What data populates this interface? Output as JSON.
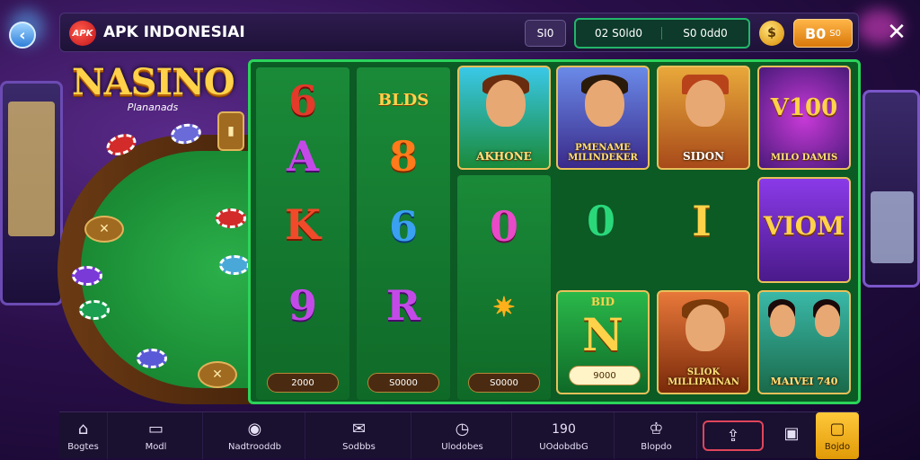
{
  "header": {
    "logo_text": "APK",
    "title": "APK INDONESIAI",
    "left_button": "SI0",
    "balance_left": "02 S0ld0",
    "balance_right": "S0 0dd0",
    "coin_icon": "coin-icon",
    "gold_button": "B0",
    "gold_button_small": "S0"
  },
  "brand": {
    "name": "NASINO",
    "subtitle": "Plananads"
  },
  "reels": [
    {
      "symbols": [
        "6",
        "A",
        "K",
        "9"
      ],
      "pill": "2000"
    },
    {
      "top_badge": "BLDS",
      "symbols": [
        "8",
        "6",
        "R"
      ],
      "pill": "S0000"
    },
    {
      "symbols": [
        "0"
      ],
      "pill": "S0000"
    }
  ],
  "middle_symbols": [
    "0",
    "I"
  ],
  "tiles": [
    {
      "label": "AKHONE"
    },
    {
      "label": "PMENAME MILINDEKER"
    },
    {
      "label": "SIDON"
    },
    {
      "label": "V100",
      "caption": "MILO DAMIS"
    },
    {
      "label": "VIOM"
    },
    {
      "label": "N",
      "badge": "BID",
      "pill": "9000"
    },
    {
      "label": "SLIOK MILLIPAINAN"
    },
    {
      "label": "MAIVEI 740"
    }
  ],
  "nav": [
    {
      "label": "Bogtes",
      "icon": "home-icon"
    },
    {
      "label": "Modl",
      "icon": "bag-icon"
    },
    {
      "label": "Nadtrooddb",
      "icon": "spin-icon"
    },
    {
      "label": "Sodbbs",
      "icon": "mail-icon"
    },
    {
      "label": "Ulodobes",
      "icon": "clock-icon"
    },
    {
      "label": "UOdobdbG",
      "value": "190",
      "icon": ""
    },
    {
      "label": "Blopdo",
      "icon": "trophy-icon"
    },
    {
      "label": "",
      "icon": "share-icon"
    },
    {
      "label": "",
      "icon": "gift-icon"
    },
    {
      "label": "Bojdo",
      "icon": "profile-icon"
    }
  ],
  "colors": {
    "accent_green": "#2bd35a",
    "gold": "#ffc83a",
    "bg_purple": "#2a0f4a"
  }
}
